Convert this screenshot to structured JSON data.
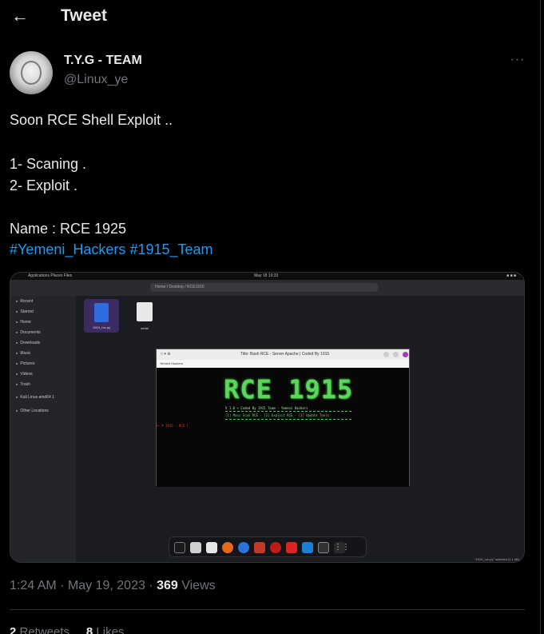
{
  "header": {
    "back_icon": "arrow-left-icon",
    "title": "Tweet"
  },
  "author": {
    "name": "T.Y.G - TEAM",
    "handle": "@Linux_ye",
    "more_icon": "more-horizontal-icon"
  },
  "tweet": {
    "lines": [
      "Soon RCE Shell Exploit ..",
      "1- Scaning .",
      "2- Exploit .",
      "Name : RCE 1925"
    ],
    "hashtags": [
      "#Yemeni_Hackers",
      "#1915_Team"
    ]
  },
  "media": {
    "topbar_left": "Applications   Places   Files",
    "topbar_center": "May 18  19:33",
    "path": "Home  /  Desktop  /  RCE1915",
    "sidebar": [
      "Recent",
      "Starred",
      "Home",
      "Documents",
      "Downloads",
      "Music",
      "Pictures",
      "Videos",
      "Trash",
      "Kali Linux amd64 1",
      "Other Locations"
    ],
    "file_py": "1915_rce.py",
    "file_txt": "serial",
    "terminal_title": "Title: Bash RCE - Server Apache | Coded By 1915",
    "terminal_tab": "Yemeni Hackers",
    "logo": "RCE 1915",
    "sub": "V 1.0 +     Coded By 1915 Team - Yemeni Hackers",
    "menu": "[1] Mass Scan RCE  -  [2] Exploit RCE  -  [3] Update Tools",
    "prompt": "└─ # 1915 - RCE ]",
    "status": "\"1915_rce.py\" selected (1.1 kB)"
  },
  "meta": {
    "time": "1:24 AM · May 19, 2023 · ",
    "views_count": "369",
    "views_label": " Views"
  },
  "stats": {
    "retweets_count": "2",
    "retweets_label": " Retweets",
    "likes_count": "8",
    "likes_label": " Likes"
  },
  "colors": {
    "background": "#000000",
    "text": "#e7e9ea",
    "muted": "#71767b",
    "accent": "#1d9bf0"
  }
}
